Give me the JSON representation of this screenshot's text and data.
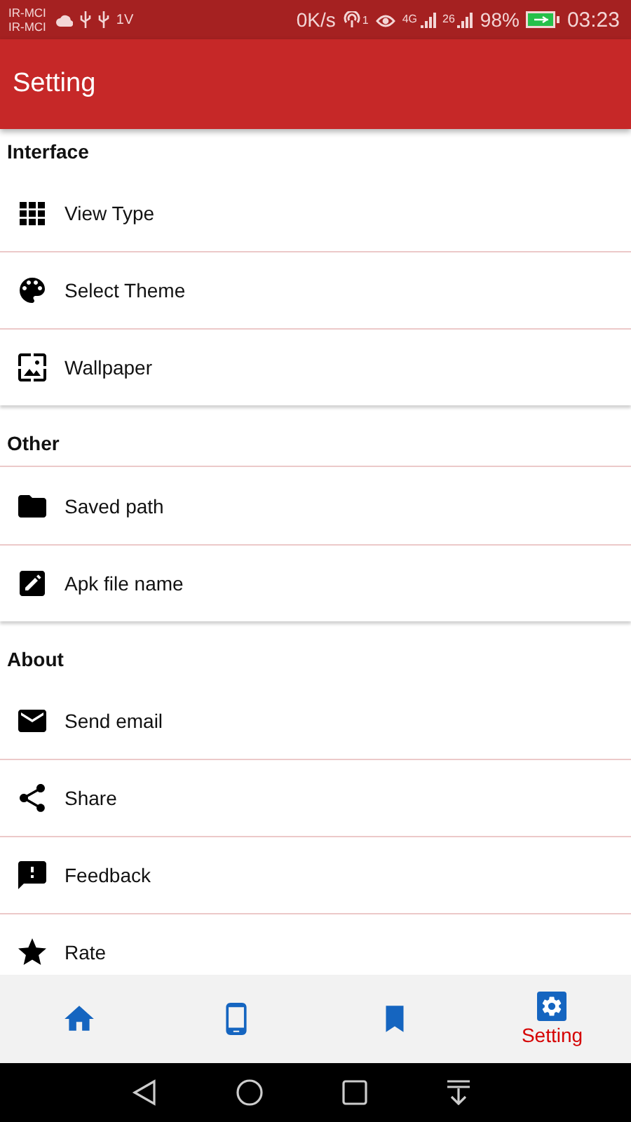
{
  "status_bar": {
    "carriers": [
      "IR-MCI",
      "IR-MCI"
    ],
    "usb_label": "1V",
    "speed": "0K/s",
    "hotspot_count": "1",
    "network_1": "4G",
    "network_2": "26",
    "battery": "98%",
    "time": "03:23"
  },
  "app_bar": {
    "title": "Setting"
  },
  "sections": [
    {
      "title": "Interface",
      "items": [
        {
          "label": "View Type"
        },
        {
          "label": "Select Theme"
        },
        {
          "label": "Wallpaper"
        }
      ]
    },
    {
      "title": "Other",
      "items": [
        {
          "label": "Saved path"
        },
        {
          "label": "Apk file name"
        }
      ]
    },
    {
      "title": "About",
      "items": [
        {
          "label": "Send email"
        },
        {
          "label": "Share"
        },
        {
          "label": "Feedback"
        },
        {
          "label": "Rate"
        }
      ]
    }
  ],
  "bottom_nav": [
    {
      "selected": false
    },
    {
      "selected": false
    },
    {
      "selected": false
    },
    {
      "label": "Setting",
      "selected": true
    }
  ]
}
